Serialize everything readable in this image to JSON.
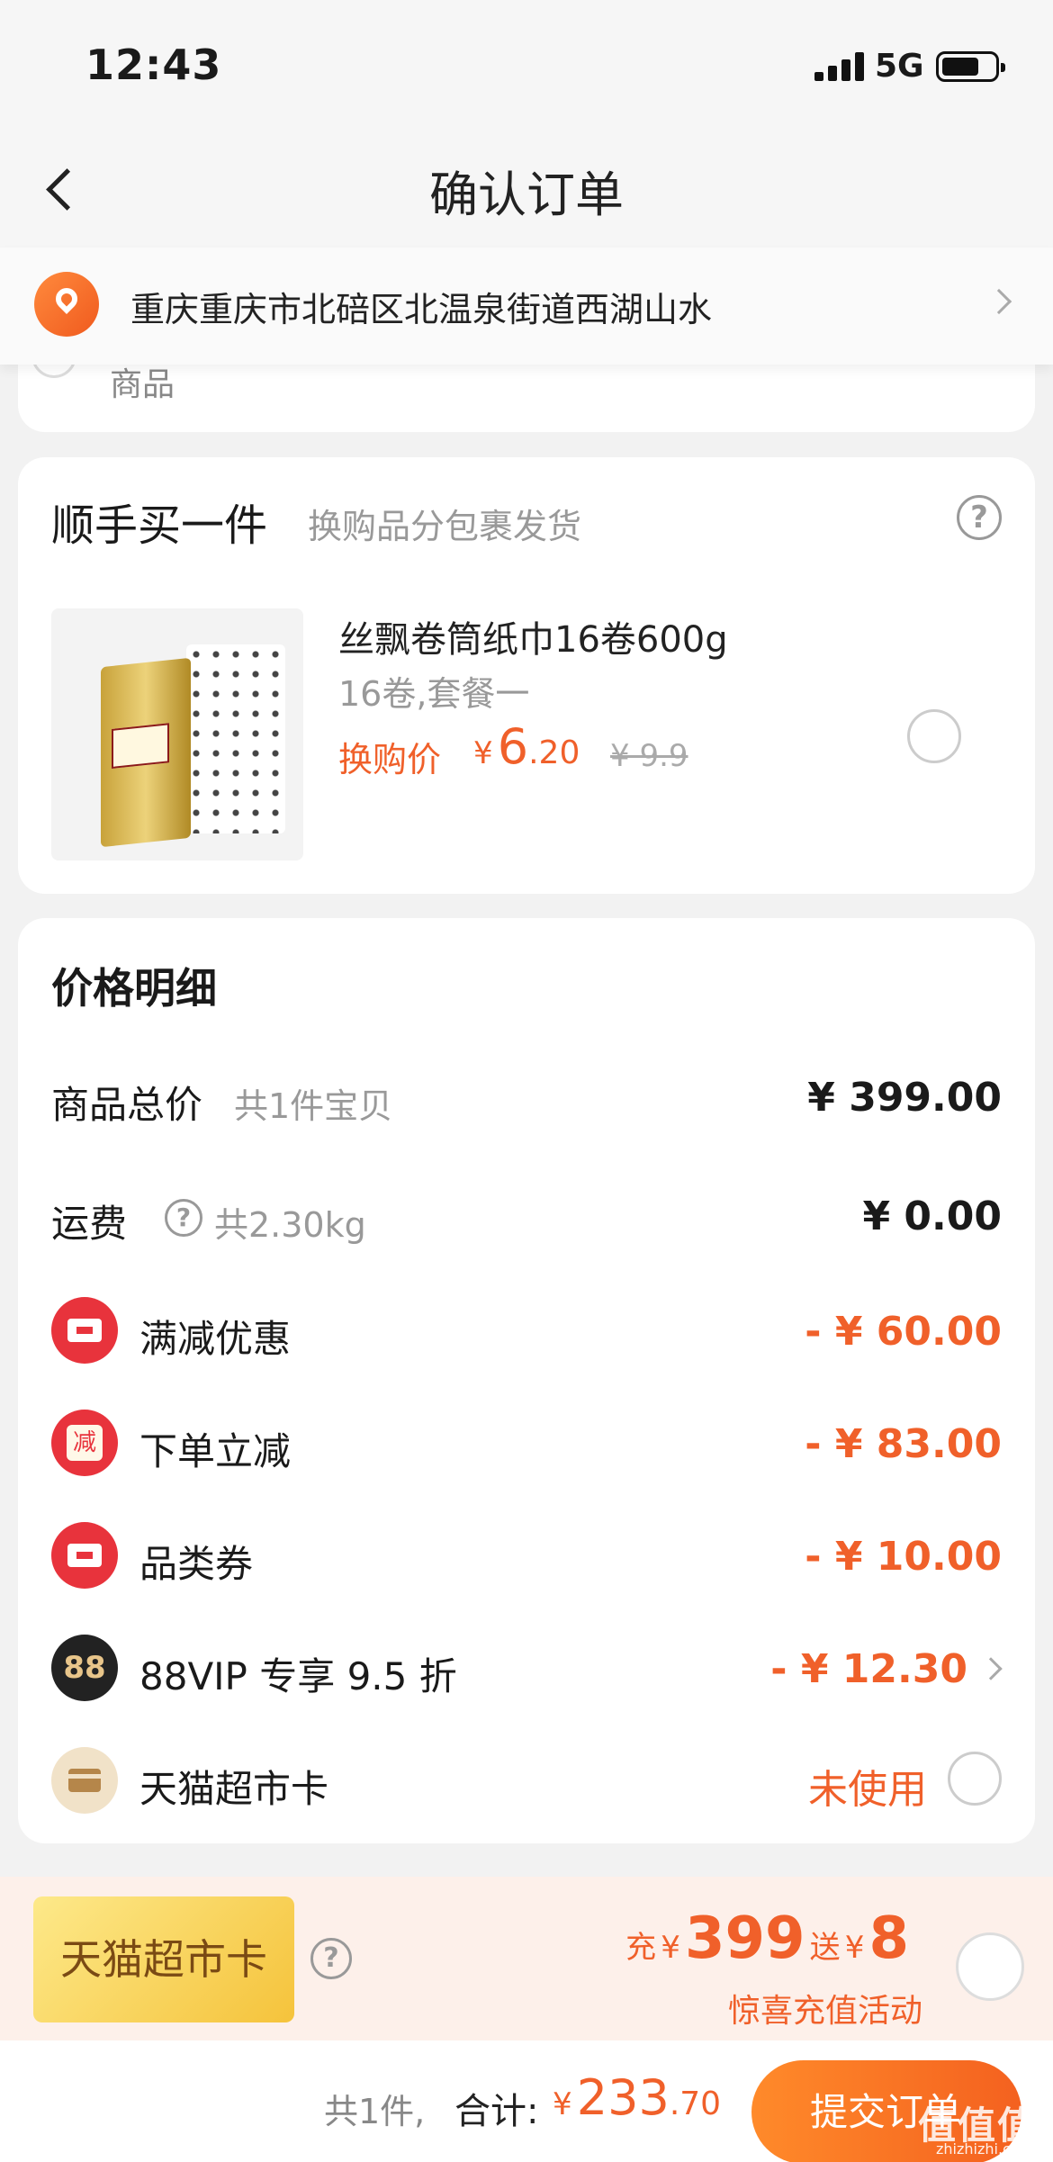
{
  "status_bar": {
    "time": "12:43",
    "network": "5G"
  },
  "nav": {
    "title": "确认订单"
  },
  "address": {
    "text": "重庆重庆市北碚区北温泉街道西湖山水"
  },
  "prev_card": {
    "text": "商品"
  },
  "addon": {
    "title": "顺手买一件",
    "subtitle": "换购品分包裹发货",
    "help_icon": "?",
    "product": {
      "name": "丝飘卷筒纸巾16卷600g",
      "spec": "16卷,套餐一",
      "price_label": "换购价",
      "currency": "¥",
      "price_int": "6",
      "price_dec": ".20",
      "original_price": "¥ 9.9"
    }
  },
  "detail": {
    "title": "价格明细",
    "goods_total": {
      "label": "商品总价",
      "sub": "共1件宝贝",
      "value": "¥ 399.00"
    },
    "shipping": {
      "label": "运费",
      "help": "?",
      "sub": "共2.30kg",
      "value": "¥ 0.00"
    },
    "discounts": [
      {
        "label": "满减优惠",
        "value": "- ¥ 60.00",
        "icon": "ticket-icon"
      },
      {
        "label": "下单立减",
        "value": "- ¥ 83.00",
        "icon": "jian-icon",
        "icon_text": "减"
      },
      {
        "label": "品类券",
        "value": "- ¥ 10.00",
        "icon": "ticket-icon"
      },
      {
        "label": "88VIP 专享 9.5 折",
        "value": "- ¥ 12.30",
        "icon": "vip-icon",
        "icon_text": "88"
      }
    ],
    "supermarket_card": {
      "label": "天猫超市卡",
      "status": "未使用"
    }
  },
  "promo": {
    "card_label": "天猫超市卡",
    "help": "?",
    "charge_word": "充",
    "currency": "¥",
    "charge_amount": "399",
    "gift_word": "送",
    "gift_amount": "8",
    "sub": "惊喜充值活动"
  },
  "bottom": {
    "count": "共1件,",
    "total_label": "合计:",
    "currency": "¥",
    "total_int": "233",
    "total_dec": ".70",
    "submit_label": "提交订单",
    "watermark": "值值值",
    "watermark_url": "zhizhizhi.com"
  },
  "colors": {
    "accent": "#f0602a",
    "red_icon": "#e8333c"
  }
}
